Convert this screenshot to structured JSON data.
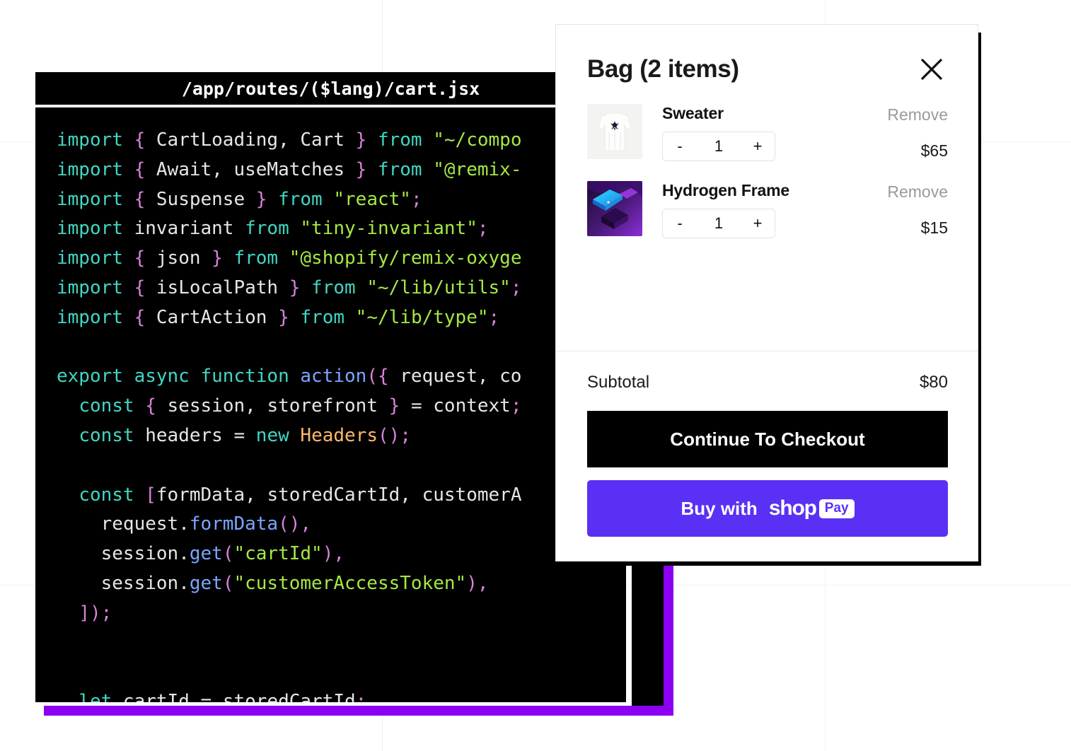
{
  "background": {
    "page_color": "#ffffff",
    "grid_color": "#f0f0f2"
  },
  "code_window": {
    "title": "/app/routes/($lang)/cart.jsx",
    "accent_color": "#8b00f0",
    "background": "#000000",
    "lines": [
      [
        {
          "t": "import",
          "c": "kw"
        },
        {
          "t": " ",
          "c": "op"
        },
        {
          "t": "{",
          "c": "punc"
        },
        {
          "t": " CartLoading, Cart ",
          "c": "var"
        },
        {
          "t": "}",
          "c": "punc"
        },
        {
          "t": " ",
          "c": "op"
        },
        {
          "t": "from",
          "c": "kw"
        },
        {
          "t": " ",
          "c": "op"
        },
        {
          "t": "\"~/compo",
          "c": "str"
        }
      ],
      [
        {
          "t": "import",
          "c": "kw"
        },
        {
          "t": " ",
          "c": "op"
        },
        {
          "t": "{",
          "c": "punc"
        },
        {
          "t": " Await, useMatches ",
          "c": "var"
        },
        {
          "t": "}",
          "c": "punc"
        },
        {
          "t": " ",
          "c": "op"
        },
        {
          "t": "from",
          "c": "kw"
        },
        {
          "t": " ",
          "c": "op"
        },
        {
          "t": "\"@remix-",
          "c": "str"
        }
      ],
      [
        {
          "t": "import",
          "c": "kw"
        },
        {
          "t": " ",
          "c": "op"
        },
        {
          "t": "{",
          "c": "punc"
        },
        {
          "t": " Suspense ",
          "c": "var"
        },
        {
          "t": "}",
          "c": "punc"
        },
        {
          "t": " ",
          "c": "op"
        },
        {
          "t": "from",
          "c": "kw"
        },
        {
          "t": " ",
          "c": "op"
        },
        {
          "t": "\"react\"",
          "c": "str"
        },
        {
          "t": ";",
          "c": "punc"
        }
      ],
      [
        {
          "t": "import",
          "c": "kw"
        },
        {
          "t": " invariant ",
          "c": "var"
        },
        {
          "t": "from",
          "c": "kw"
        },
        {
          "t": " ",
          "c": "op"
        },
        {
          "t": "\"tiny-invariant\"",
          "c": "str"
        },
        {
          "t": ";",
          "c": "punc"
        }
      ],
      [
        {
          "t": "import",
          "c": "kw"
        },
        {
          "t": " ",
          "c": "op"
        },
        {
          "t": "{",
          "c": "punc"
        },
        {
          "t": " json ",
          "c": "var"
        },
        {
          "t": "}",
          "c": "punc"
        },
        {
          "t": " ",
          "c": "op"
        },
        {
          "t": "from",
          "c": "kw"
        },
        {
          "t": " ",
          "c": "op"
        },
        {
          "t": "\"@shopify/remix-oxyge",
          "c": "str"
        }
      ],
      [
        {
          "t": "import",
          "c": "kw"
        },
        {
          "t": " ",
          "c": "op"
        },
        {
          "t": "{",
          "c": "punc"
        },
        {
          "t": " isLocalPath ",
          "c": "var"
        },
        {
          "t": "}",
          "c": "punc"
        },
        {
          "t": " ",
          "c": "op"
        },
        {
          "t": "from",
          "c": "kw"
        },
        {
          "t": " ",
          "c": "op"
        },
        {
          "t": "\"~/lib/utils\"",
          "c": "str"
        },
        {
          "t": ";",
          "c": "punc"
        }
      ],
      [
        {
          "t": "import",
          "c": "kw"
        },
        {
          "t": " ",
          "c": "op"
        },
        {
          "t": "{",
          "c": "punc"
        },
        {
          "t": " CartAction ",
          "c": "var"
        },
        {
          "t": "}",
          "c": "punc"
        },
        {
          "t": " ",
          "c": "op"
        },
        {
          "t": "from",
          "c": "kw"
        },
        {
          "t": " ",
          "c": "op"
        },
        {
          "t": "\"~/lib/type\"",
          "c": "str"
        },
        {
          "t": ";",
          "c": "punc"
        }
      ],
      [],
      [
        {
          "t": "export async function",
          "c": "kw"
        },
        {
          "t": " ",
          "c": "op"
        },
        {
          "t": "action",
          "c": "fn"
        },
        {
          "t": "(",
          "c": "punc"
        },
        {
          "t": "{",
          "c": "punc"
        },
        {
          "t": " request, co",
          "c": "var"
        }
      ],
      [
        {
          "t": "  ",
          "c": "op"
        },
        {
          "t": "const",
          "c": "kw"
        },
        {
          "t": " ",
          "c": "op"
        },
        {
          "t": "{",
          "c": "punc"
        },
        {
          "t": " session, storefront ",
          "c": "var"
        },
        {
          "t": "}",
          "c": "punc"
        },
        {
          "t": " = ",
          "c": "op"
        },
        {
          "t": "context",
          "c": "var"
        },
        {
          "t": ";",
          "c": "punc"
        }
      ],
      [
        {
          "t": "  ",
          "c": "op"
        },
        {
          "t": "const",
          "c": "kw"
        },
        {
          "t": " headers ",
          "c": "var"
        },
        {
          "t": "= ",
          "c": "op"
        },
        {
          "t": "new",
          "c": "kw"
        },
        {
          "t": " ",
          "c": "op"
        },
        {
          "t": "Headers",
          "c": "cls"
        },
        {
          "t": "()",
          "c": "punc"
        },
        {
          "t": ";",
          "c": "punc"
        }
      ],
      [],
      [
        {
          "t": "  ",
          "c": "op"
        },
        {
          "t": "const",
          "c": "kw"
        },
        {
          "t": " ",
          "c": "op"
        },
        {
          "t": "[",
          "c": "punc"
        },
        {
          "t": "formData, storedCartId, customerA",
          "c": "var"
        }
      ],
      [
        {
          "t": "    request",
          "c": "var"
        },
        {
          "t": ".",
          "c": "op"
        },
        {
          "t": "formData",
          "c": "fn"
        },
        {
          "t": "()",
          "c": "punc"
        },
        {
          "t": ",",
          "c": "punc"
        }
      ],
      [
        {
          "t": "    session",
          "c": "var"
        },
        {
          "t": ".",
          "c": "op"
        },
        {
          "t": "get",
          "c": "fn"
        },
        {
          "t": "(",
          "c": "punc"
        },
        {
          "t": "\"cartId\"",
          "c": "str"
        },
        {
          "t": ")",
          "c": "punc"
        },
        {
          "t": ",",
          "c": "punc"
        }
      ],
      [
        {
          "t": "    session",
          "c": "var"
        },
        {
          "t": ".",
          "c": "op"
        },
        {
          "t": "get",
          "c": "fn"
        },
        {
          "t": "(",
          "c": "punc"
        },
        {
          "t": "\"customerAccessToken\"",
          "c": "str"
        },
        {
          "t": ")",
          "c": "punc"
        },
        {
          "t": ",",
          "c": "punc"
        }
      ],
      [
        {
          "t": "  ",
          "c": "op"
        },
        {
          "t": "]);",
          "c": "punc"
        }
      ],
      [],
      [],
      [
        {
          "t": "  ",
          "c": "op"
        },
        {
          "t": "let",
          "c": "kw"
        },
        {
          "t": " cartId ",
          "c": "var"
        },
        {
          "t": "= ",
          "c": "op"
        },
        {
          "t": "storedCartId",
          "c": "var"
        },
        {
          "t": ";",
          "c": "punc"
        }
      ]
    ]
  },
  "cart": {
    "title": "Bag (2 items)",
    "close_icon": "close-icon",
    "items": [
      {
        "name": "Sweater",
        "remove_label": "Remove",
        "quantity": "1",
        "decrement_label": "-",
        "increment_label": "+",
        "price": "$65",
        "thumb": "white-knit-sweater-photo"
      },
      {
        "name": "Hydrogen Frame",
        "remove_label": "Remove",
        "quantity": "1",
        "decrement_label": "-",
        "increment_label": "+",
        "price": "$15",
        "thumb": "purple-3d-isometric-render"
      }
    ],
    "subtotal_label": "Subtotal",
    "subtotal_value": "$80",
    "checkout_label": "Continue To Checkout",
    "shoppay": {
      "prefix": "Buy with",
      "brand": "shop",
      "badge": "Pay",
      "color": "#5a31f4"
    }
  }
}
